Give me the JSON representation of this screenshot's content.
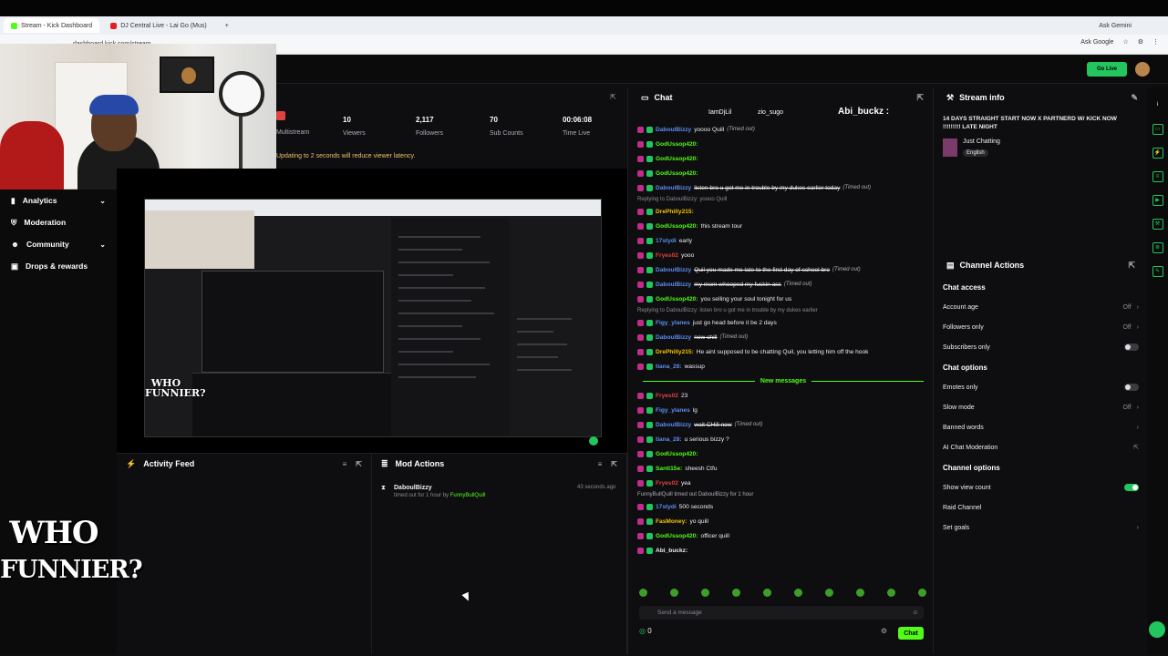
{
  "browser": {
    "tabs": [
      {
        "title": "Stream - Kick Dashboard",
        "active": true
      },
      {
        "title": "DJ Central Live - Lai Go (Mus)",
        "active": false
      }
    ],
    "address": "dashboard.kick.com/stream",
    "ask_gemini": "Ask Gemini",
    "ask_google": "Ask Google"
  },
  "header": {
    "go_live_label": "Go Live"
  },
  "stats": {
    "multistream_label": "Multistream",
    "viewers": {
      "value": "10",
      "label": "Viewers"
    },
    "followers": {
      "value": "2,117",
      "label": "Followers"
    },
    "subs": {
      "value": "70",
      "label": "Sub Counts"
    },
    "time": {
      "value": "00:06:08",
      "label": "Time Live"
    },
    "latency_note": "Updating to 2 seconds will reduce viewer latency."
  },
  "sidebar": {
    "items": [
      {
        "label": "Analytics",
        "expandable": true
      },
      {
        "label": "Moderation",
        "expandable": false
      },
      {
        "label": "Community",
        "expandable": true
      },
      {
        "label": "Drops & rewards",
        "expandable": false
      }
    ]
  },
  "watermark": {
    "text_line1": "WHO",
    "text_line2": "FUNNIER?"
  },
  "activity_feed": {
    "title": "Activity Feed"
  },
  "mod_actions": {
    "title": "Mod Actions",
    "entry": {
      "user": "DaboulBizzy",
      "detail": "timed out for 1 hour by",
      "by": "FunnyBullQuill",
      "time": "43 seconds ago"
    }
  },
  "chat": {
    "title": "Chat",
    "pinned_users": [
      "IamDjLil",
      "zio_sugo"
    ],
    "pinned_highlight": "Abi_buckz :",
    "new_messages_label": "New messages",
    "input_placeholder": "Send a message",
    "count": "0",
    "send_label": "Chat",
    "messages": [
      {
        "user": "DaboulBizzy",
        "color": "#5b8ef0",
        "text": "yoooo Quill",
        "note": "(Timed out)",
        "strike": false
      },
      {
        "user": "GodUssop420:",
        "color": "#53fc18",
        "text": "",
        "note": "",
        "strike": false
      },
      {
        "user": "GodUssop420:",
        "color": "#53fc18",
        "text": "",
        "note": "",
        "strike": false
      },
      {
        "user": "GodUssop420:",
        "color": "#53fc18",
        "text": "",
        "note": "",
        "strike": false
      },
      {
        "user": "DaboulBizzy",
        "color": "#5b8ef0",
        "text": "listen bro u got me in trouble by my dukes earlier today",
        "note": "(Timed out)",
        "strike": true
      },
      {
        "reply": "Replying to DaboulBizzy: yoooo Quill"
      },
      {
        "user": "DrePhilly215:",
        "color": "#f3c100",
        "text": "",
        "note": "",
        "strike": false
      },
      {
        "user": "GodUssop420:",
        "color": "#53fc18",
        "text": "this stream tour",
        "note": "",
        "strike": false
      },
      {
        "user": "17stydi",
        "color": "#5b8ef0",
        "text": "early",
        "note": "",
        "strike": false
      },
      {
        "user": "Fryes02",
        "color": "#e04141",
        "text": "yooo",
        "note": "",
        "strike": false
      },
      {
        "user": "DaboulBizzy",
        "color": "#5b8ef0",
        "text": "Quil you made me late to the first day of school bro",
        "note": "(Timed out)",
        "strike": true
      },
      {
        "user": "DaboulBizzy",
        "color": "#5b8ef0",
        "text": "my mom whooped my fuckin ass",
        "note": "(Timed out)",
        "strike": true
      },
      {
        "user": "GodUssop420:",
        "color": "#53fc18",
        "text": "you selling your soul tonight for us",
        "note": "",
        "strike": false
      },
      {
        "reply": "Replying to DaboulBizzy: listen bro u got me in trouble by my dukes earlier"
      },
      {
        "user": "Figy_ylanes",
        "color": "#5b8ef0",
        "text": "just go head before it be 2 days",
        "note": "",
        "strike": false
      },
      {
        "user": "DaboulBizzy",
        "color": "#5b8ef0",
        "text": "new chill",
        "note": "(Timed out)",
        "strike": true
      },
      {
        "user": "DrePhilly215:",
        "color": "#f3c100",
        "text": "He aint supposed to be chatting Quil, you letting him off the hook",
        "note": "",
        "strike": false
      },
      {
        "user": "tiana_28:",
        "color": "#5b8ef0",
        "text": "wassup",
        "note": "",
        "strike": false
      },
      {
        "new": true
      },
      {
        "user": "Fryes02",
        "color": "#e04141",
        "text": "23",
        "note": "",
        "strike": false
      },
      {
        "user": "Figy_ylanes",
        "color": "#5b8ef0",
        "text": "lg",
        "note": "",
        "strike": false
      },
      {
        "user": "DaboulBizzy",
        "color": "#5b8ef0",
        "text": "wait CHill now",
        "note": "(Timed out)",
        "strike": true
      },
      {
        "user": "tiana_28:",
        "color": "#5b8ef0",
        "text": "u serious bizzy ?",
        "note": "",
        "strike": false
      },
      {
        "user": "GodUssop420:",
        "color": "#53fc18",
        "text": "",
        "note": "",
        "strike": false
      },
      {
        "user": "Santi15e:",
        "color": "#53fc18",
        "text": "sheesh Ctfu",
        "note": "",
        "strike": false
      },
      {
        "user": "Fryes02",
        "color": "#e04141",
        "text": "yea",
        "note": "",
        "strike": false
      },
      {
        "system": "FunnyBullQuill timed out DaboulBizzy for 1 hour"
      },
      {
        "user": "17stydi",
        "color": "#5b8ef0",
        "text": "500 seconds",
        "note": "",
        "strike": false
      },
      {
        "user": "FasMoney:",
        "color": "#f3c100",
        "text": "yo quill",
        "note": "",
        "strike": false
      },
      {
        "user": "GodUssop420:",
        "color": "#53fc18",
        "text": "officer quill",
        "note": "",
        "strike": false
      },
      {
        "user": "Abi_buckz:",
        "color": "#efeff1",
        "text": "",
        "note": "",
        "strike": false
      }
    ]
  },
  "stream_info": {
    "title": "Stream info",
    "stream_title": "14 DAYS STRAIGHT START NOW X PARTNERD W/ KICK NOW !!!!!!!!! LATE NIGHT",
    "category": "Just Chatting",
    "language": "English"
  },
  "channel_actions": {
    "title": "Channel Actions",
    "chat_access_label": "Chat access",
    "chat_access": [
      {
        "label": "Account age",
        "value": "Off",
        "kind": "arrow"
      },
      {
        "label": "Followers only",
        "value": "Off",
        "kind": "arrow"
      },
      {
        "label": "Subscribers only",
        "value": "",
        "kind": "toggle",
        "on": false
      }
    ],
    "chat_options_label": "Chat options",
    "chat_options": [
      {
        "label": "Emotes only",
        "value": "",
        "kind": "toggle",
        "on": false
      },
      {
        "label": "Slow mode",
        "value": "Off",
        "kind": "arrow"
      },
      {
        "label": "Banned words",
        "value": "",
        "kind": "arrow"
      },
      {
        "label": "AI Chat Moderation",
        "value": "",
        "kind": "external"
      }
    ],
    "channel_options_label": "Channel options",
    "channel_options": [
      {
        "label": "Show view count",
        "value": "",
        "kind": "toggle",
        "on": true
      },
      {
        "label": "Raid Channel",
        "value": "",
        "kind": "none"
      },
      {
        "label": "Set goals",
        "value": "",
        "kind": "arrow"
      }
    ]
  },
  "colors": {
    "accent": "#53fc18",
    "bg": "#0e0e10",
    "golive": "#22c55e"
  }
}
